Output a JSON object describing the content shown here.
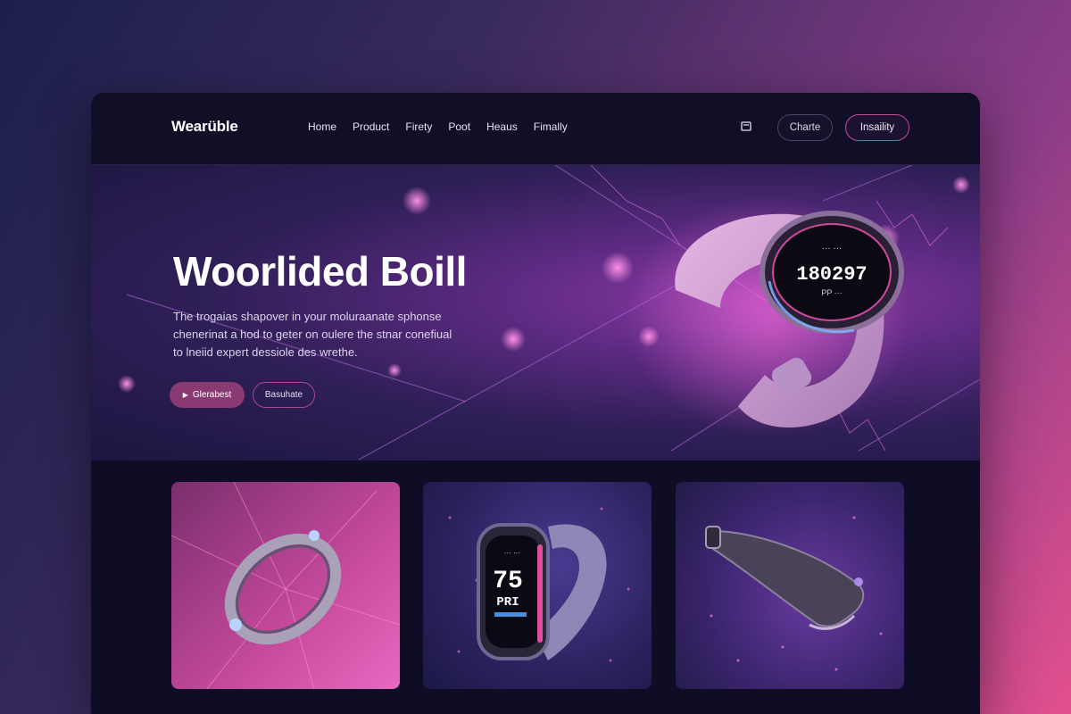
{
  "header": {
    "logo": "Wearüble",
    "nav": [
      "Home",
      "Product",
      "Firety",
      "Poot",
      "Heaus",
      "Fimally"
    ],
    "buttons": {
      "secondary": "Charte",
      "primary": "Insaility"
    }
  },
  "hero": {
    "title": "Woorlided Boill",
    "description": "The trogaias shapover in your moluraanate sphonse chenerinat a hod to geter on oulere the stnar conefiual to lneiid expert dessiole des wrethe.",
    "cta_primary": "Glerabest",
    "cta_secondary": "Basuhate",
    "watch_display": {
      "top": "··· ···",
      "main": "180297",
      "bottom": "PP ···"
    }
  },
  "cards": [
    {
      "name": "ring"
    },
    {
      "name": "smartwatch",
      "display": {
        "top": "··· ···",
        "main": "75",
        "sub": "PRI"
      }
    },
    {
      "name": "band"
    }
  ],
  "colors": {
    "accent": "#c0508f",
    "background": "#0f0d24",
    "hero": "#5b2a80"
  }
}
